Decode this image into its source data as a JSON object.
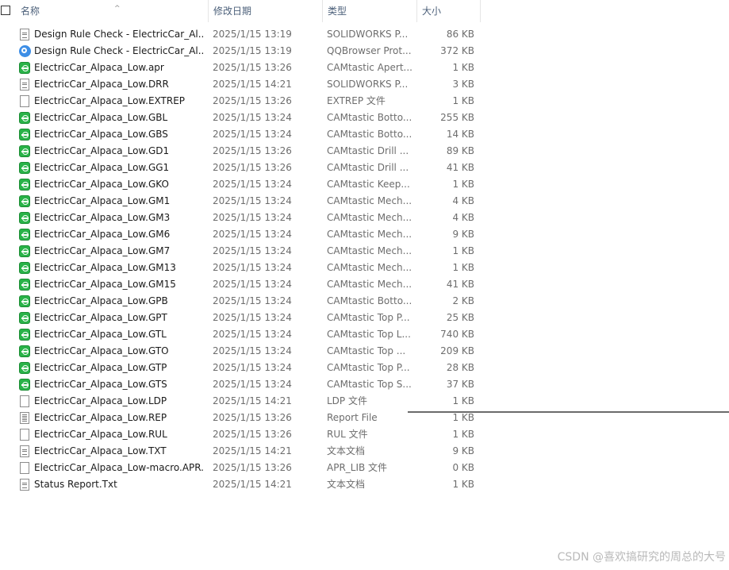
{
  "columns": {
    "name": "名称",
    "date": "修改日期",
    "type": "类型",
    "size": "大小"
  },
  "files": [
    {
      "icon": "doc",
      "name": "Design Rule Check - ElectricCar_Al...",
      "date": "2025/1/15 13:19",
      "type": "SOLIDWORKS P...",
      "size": "86 KB"
    },
    {
      "icon": "browser",
      "name": "Design Rule Check - ElectricCar_Al...",
      "date": "2025/1/15 13:19",
      "type": "QQBrowser Prot...",
      "size": "372 KB"
    },
    {
      "icon": "green",
      "name": "ElectricCar_Alpaca_Low.apr",
      "date": "2025/1/15 13:26",
      "type": "CAMtastic Apert...",
      "size": "1 KB"
    },
    {
      "icon": "doc",
      "name": "ElectricCar_Alpaca_Low.DRR",
      "date": "2025/1/15 14:21",
      "type": "SOLIDWORKS P...",
      "size": "3 KB"
    },
    {
      "icon": "blank",
      "name": "ElectricCar_Alpaca_Low.EXTREP",
      "date": "2025/1/15 13:26",
      "type": "EXTREP 文件",
      "size": "1 KB"
    },
    {
      "icon": "green",
      "name": "ElectricCar_Alpaca_Low.GBL",
      "date": "2025/1/15 13:24",
      "type": "CAMtastic Botto...",
      "size": "255 KB"
    },
    {
      "icon": "green",
      "name": "ElectricCar_Alpaca_Low.GBS",
      "date": "2025/1/15 13:24",
      "type": "CAMtastic Botto...",
      "size": "14 KB"
    },
    {
      "icon": "green",
      "name": "ElectricCar_Alpaca_Low.GD1",
      "date": "2025/1/15 13:26",
      "type": "CAMtastic Drill ...",
      "size": "89 KB"
    },
    {
      "icon": "green",
      "name": "ElectricCar_Alpaca_Low.GG1",
      "date": "2025/1/15 13:26",
      "type": "CAMtastic Drill ...",
      "size": "41 KB"
    },
    {
      "icon": "green",
      "name": "ElectricCar_Alpaca_Low.GKO",
      "date": "2025/1/15 13:24",
      "type": "CAMtastic Keep...",
      "size": "1 KB"
    },
    {
      "icon": "green",
      "name": "ElectricCar_Alpaca_Low.GM1",
      "date": "2025/1/15 13:24",
      "type": "CAMtastic Mech...",
      "size": "4 KB"
    },
    {
      "icon": "green",
      "name": "ElectricCar_Alpaca_Low.GM3",
      "date": "2025/1/15 13:24",
      "type": "CAMtastic Mech...",
      "size": "4 KB"
    },
    {
      "icon": "green",
      "name": "ElectricCar_Alpaca_Low.GM6",
      "date": "2025/1/15 13:24",
      "type": "CAMtastic Mech...",
      "size": "9 KB"
    },
    {
      "icon": "green",
      "name": "ElectricCar_Alpaca_Low.GM7",
      "date": "2025/1/15 13:24",
      "type": "CAMtastic Mech...",
      "size": "1 KB"
    },
    {
      "icon": "green",
      "name": "ElectricCar_Alpaca_Low.GM13",
      "date": "2025/1/15 13:24",
      "type": "CAMtastic Mech...",
      "size": "1 KB"
    },
    {
      "icon": "green",
      "name": "ElectricCar_Alpaca_Low.GM15",
      "date": "2025/1/15 13:24",
      "type": "CAMtastic Mech...",
      "size": "41 KB"
    },
    {
      "icon": "green",
      "name": "ElectricCar_Alpaca_Low.GPB",
      "date": "2025/1/15 13:24",
      "type": "CAMtastic Botto...",
      "size": "2 KB"
    },
    {
      "icon": "green",
      "name": "ElectricCar_Alpaca_Low.GPT",
      "date": "2025/1/15 13:24",
      "type": "CAMtastic Top P...",
      "size": "25 KB"
    },
    {
      "icon": "green",
      "name": "ElectricCar_Alpaca_Low.GTL",
      "date": "2025/1/15 13:24",
      "type": "CAMtastic Top L...",
      "size": "740 KB"
    },
    {
      "icon": "green",
      "name": "ElectricCar_Alpaca_Low.GTO",
      "date": "2025/1/15 13:24",
      "type": "CAMtastic Top ...",
      "size": "209 KB"
    },
    {
      "icon": "green",
      "name": "ElectricCar_Alpaca_Low.GTP",
      "date": "2025/1/15 13:24",
      "type": "CAMtastic Top P...",
      "size": "28 KB"
    },
    {
      "icon": "green",
      "name": "ElectricCar_Alpaca_Low.GTS",
      "date": "2025/1/15 13:24",
      "type": "CAMtastic Top S...",
      "size": "37 KB"
    },
    {
      "icon": "blank",
      "name": "ElectricCar_Alpaca_Low.LDP",
      "date": "2025/1/15 14:21",
      "type": "LDP 文件",
      "size": "1 KB"
    },
    {
      "icon": "report",
      "name": "ElectricCar_Alpaca_Low.REP",
      "date": "2025/1/15 13:26",
      "type": "Report File",
      "size": "1 KB"
    },
    {
      "icon": "blank",
      "name": "ElectricCar_Alpaca_Low.RUL",
      "date": "2025/1/15 13:26",
      "type": "RUL 文件",
      "size": "1 KB"
    },
    {
      "icon": "doc",
      "name": "ElectricCar_Alpaca_Low.TXT",
      "date": "2025/1/15 14:21",
      "type": "文本文档",
      "size": "9 KB"
    },
    {
      "icon": "blank",
      "name": "ElectricCar_Alpaca_Low-macro.APR...",
      "date": "2025/1/15 13:26",
      "type": "APR_LIB 文件",
      "size": "0 KB"
    },
    {
      "icon": "doc",
      "name": "Status Report.Txt",
      "date": "2025/1/15 14:21",
      "type": "文本文档",
      "size": "1 KB"
    }
  ],
  "icon_names": {
    "doc": "text-document-icon",
    "browser": "qqbrowser-file-icon",
    "green": "camtastic-file-icon",
    "blank": "blank-file-icon",
    "report": "report-file-icon"
  },
  "watermark": "CSDN @喜欢搞研究的周总的大号"
}
